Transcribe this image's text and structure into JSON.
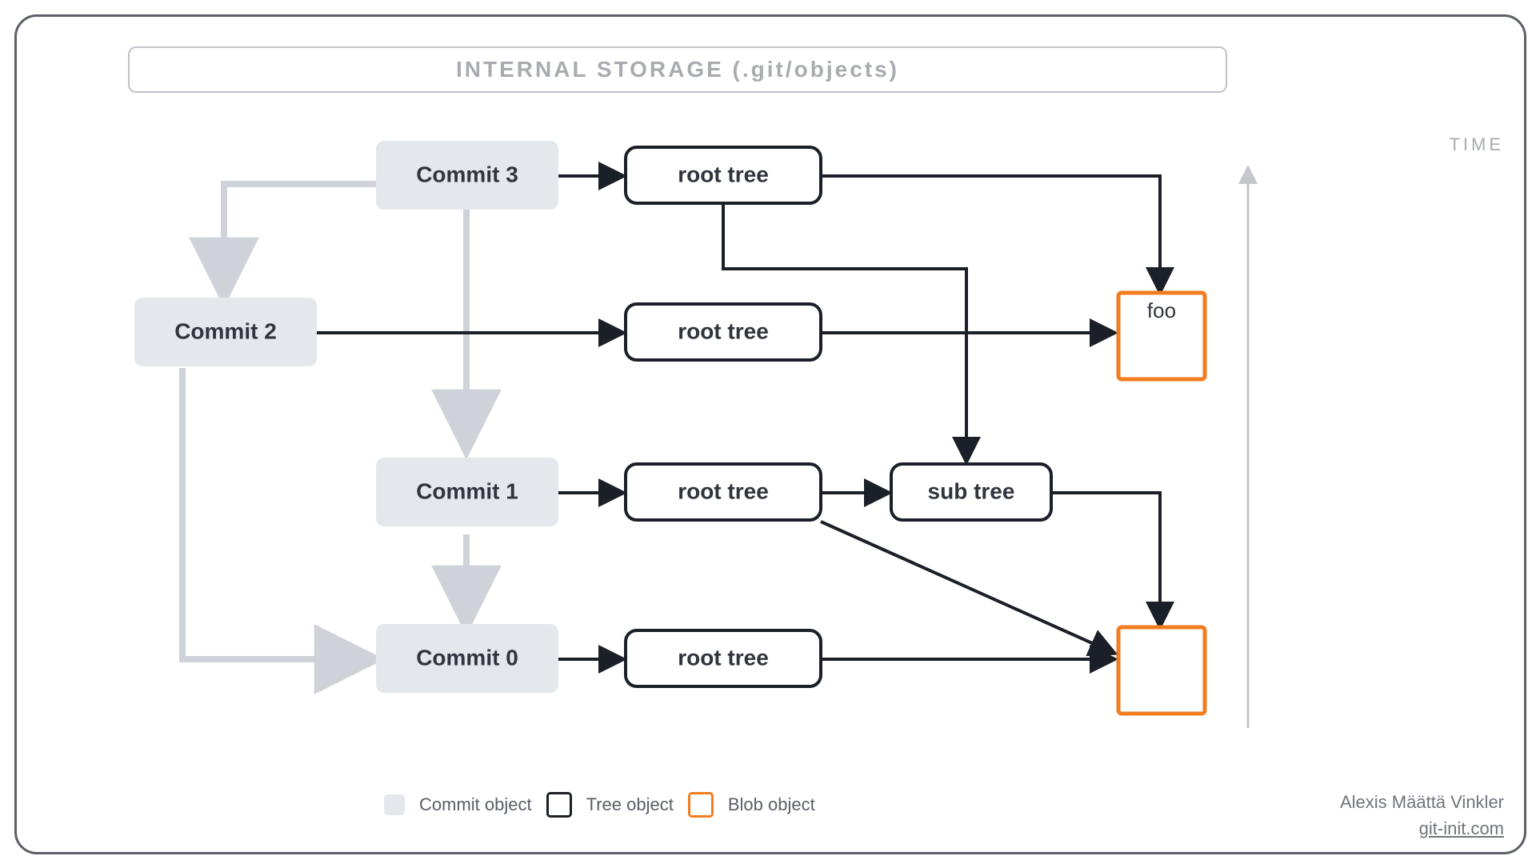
{
  "title": "INTERNAL STORAGE (.git/objects)",
  "time_label": "TIME",
  "nodes": {
    "commit3": "Commit 3",
    "commit2": "Commit 2",
    "commit1": "Commit 1",
    "commit0": "Commit 0",
    "roottree3": "root tree",
    "roottree2": "root tree",
    "roottree1": "root tree",
    "roottree0": "root tree",
    "subtree": "sub tree",
    "foo": "foo"
  },
  "legend": {
    "commit": "Commit object",
    "tree": "Tree object",
    "blob": "Blob object"
  },
  "credit": {
    "author": "Alexis Määttä Vinkler",
    "site": "git-init.com"
  },
  "colors": {
    "commit_fill": "#e4e7ec",
    "tree_stroke": "#1b1f27",
    "blob_stroke": "#f27d21",
    "grey_arrow": "#cfd2d8",
    "dark_arrow": "#1b1f27"
  },
  "diagram": {
    "description": "Git object graph showing commits pointing to tree objects which point to blob objects; parent-commit chain drawn in grey; reference arrows in black.",
    "commits": [
      "Commit 3",
      "Commit 2",
      "Commit 1",
      "Commit 0"
    ],
    "trees": [
      "root tree (x4)",
      "sub tree"
    ],
    "blobs": [
      "foo",
      "(unnamed blob)"
    ],
    "commit_parent_edges": [
      [
        "Commit 3",
        "Commit 2"
      ],
      [
        "Commit 3",
        "Commit 1"
      ],
      [
        "Commit 2",
        "Commit 0"
      ],
      [
        "Commit 1",
        "Commit 0"
      ]
    ],
    "commit_tree_edges": [
      [
        "Commit 3",
        "root tree"
      ],
      [
        "Commit 2",
        "root tree"
      ],
      [
        "Commit 1",
        "root tree"
      ],
      [
        "Commit 0",
        "root tree"
      ]
    ],
    "tree_edges": [
      [
        "root tree (c3)",
        "foo"
      ],
      [
        "root tree (c3)",
        "sub tree"
      ],
      [
        "root tree (c2)",
        "foo"
      ],
      [
        "root tree (c1)",
        "sub tree"
      ],
      [
        "root tree (c1)",
        "(unnamed blob)"
      ],
      [
        "sub tree",
        "(unnamed blob)"
      ],
      [
        "root tree (c0)",
        "(unnamed blob)"
      ]
    ]
  }
}
